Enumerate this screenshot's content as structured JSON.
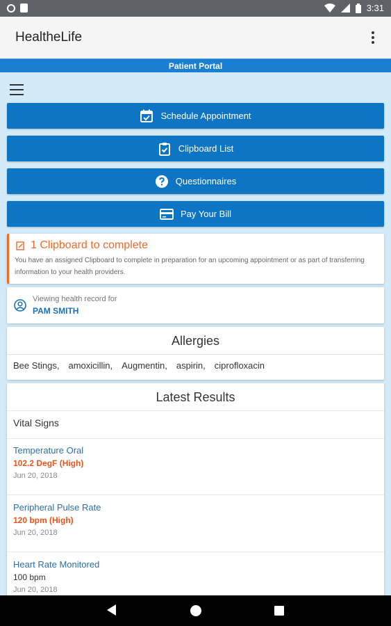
{
  "status_bar": {
    "time": "3:31"
  },
  "app_bar": {
    "title": "HealtheLife"
  },
  "portal": {
    "title": "Patient Portal"
  },
  "buttons": [
    {
      "label": "Schedule Appointment",
      "icon": "calendar-check-icon"
    },
    {
      "label": "Clipboard List",
      "icon": "clipboard-check-icon"
    },
    {
      "label": "Questionnaires",
      "icon": "question-circle-icon"
    },
    {
      "label": "Pay Your Bill",
      "icon": "credit-card-icon"
    }
  ],
  "clipboard_alert": {
    "title": "1 Clipboard to complete",
    "description": "You have an assigned Clipboard to complete in preparation for an upcoming appointment or as part of transferring information to your health providers.",
    "accent_color": "#f06a2a"
  },
  "viewing": {
    "label": "Viewing health record for",
    "name": "PAM SMITH"
  },
  "allergies": {
    "title": "Allergies",
    "items": [
      "Bee Stings,",
      "amoxicillin,",
      "Augmentin,",
      "aspirin,",
      "ciprofloxacin"
    ]
  },
  "latest_results": {
    "title": "Latest Results",
    "group": "Vital Signs",
    "items": [
      {
        "name": "Temperature Oral",
        "value": "102.2 DegF (High)",
        "date": "Jun 20, 2018",
        "status": "high"
      },
      {
        "name": "Peripheral Pulse Rate",
        "value": "120 bpm (High)",
        "date": "Jun 20, 2018",
        "status": "high"
      },
      {
        "name": "Heart Rate Monitored",
        "value": "100 bpm",
        "date": "Jun 20, 2018",
        "status": "normal"
      }
    ]
  },
  "colors": {
    "primary": "#0e74c4",
    "portal_bar": "#1a7fd0",
    "background": "#d3ebf8",
    "alert": "#f06a2a",
    "high_value": "#e8541e"
  }
}
